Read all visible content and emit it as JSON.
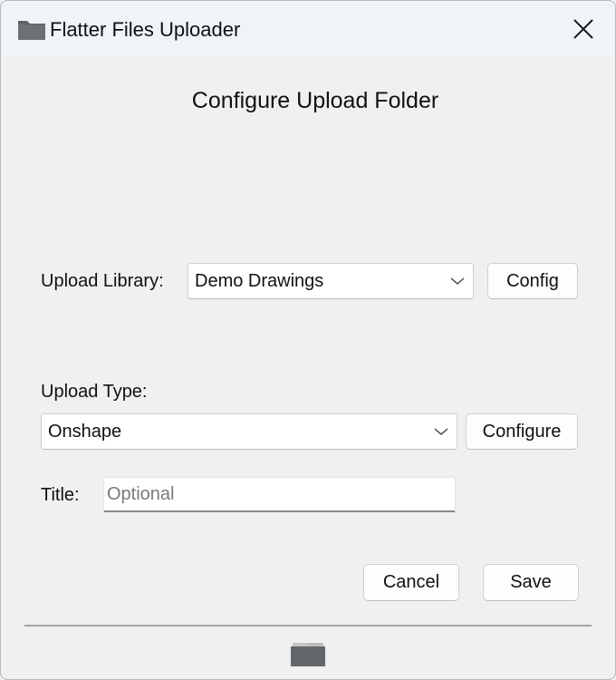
{
  "window": {
    "title": "Flatter Files Uploader",
    "title_icon": "folder-icon",
    "close_icon": "close-icon"
  },
  "dialog": {
    "heading": "Configure Upload Folder",
    "upload_library": {
      "label": "Upload Library:",
      "selected": "Demo Drawings",
      "button_label": "Config"
    },
    "upload_type": {
      "label": "Upload Type:",
      "selected": "Onshape",
      "button_label": "Configure"
    },
    "title_field": {
      "label": "Title:",
      "value": "",
      "placeholder": "Optional"
    },
    "cancel_label": "Cancel",
    "save_label": "Save",
    "footer_icon": "folder-icon"
  }
}
